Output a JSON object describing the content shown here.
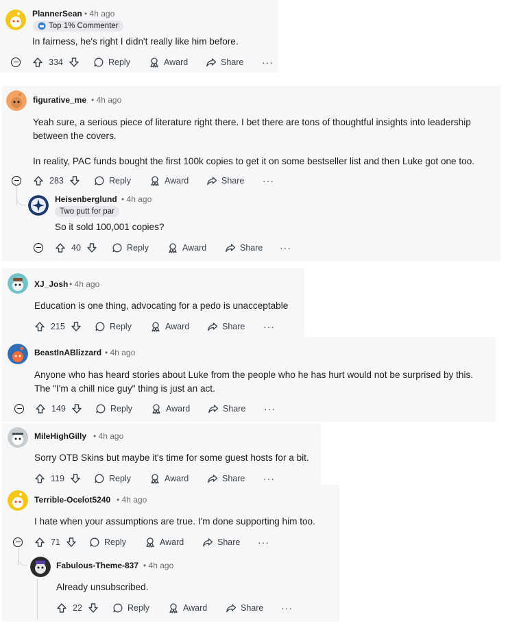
{
  "comments": [
    {
      "username": "PlannerSean",
      "time": "4h ago",
      "flair": "Top 1% Commenter",
      "lines": [
        "In fairness, he's right I didn't really like him before."
      ],
      "votes": "334",
      "reply": "Reply",
      "award": "Award",
      "share": "Share",
      "more": "···"
    },
    {
      "username": "figurative_me",
      "time": "4h ago",
      "lines": [
        "Yeah sure, a serious piece of literature right there. I bet there are tons of thoughtful insights into leadership",
        "between the covers.",
        "In reality, PAC funds bought the first 100k copies to get it on some bestseller list and then Luke got one too."
      ],
      "votes": "283",
      "reply": "Reply",
      "award": "Award",
      "share": "Share",
      "more": "···"
    },
    {
      "username": "Heisenberglund",
      "time": "4h ago",
      "flair": "Two putt for par",
      "lines": [
        "So it sold 100,001 copies?"
      ],
      "votes": "40",
      "reply": "Reply",
      "award": "Award",
      "share": "Share",
      "more": "···"
    },
    {
      "username": "XJ_Josh",
      "time": "4h ago",
      "lines": [
        "Education is one thing, advocating for a pedo is unacceptable"
      ],
      "votes": "215",
      "reply": "Reply",
      "award": "Award",
      "share": "Share",
      "more": "···"
    },
    {
      "username": "BeastInABlizzard",
      "time": "4h ago",
      "lines": [
        "Anyone who has heard stories about Luke from the people who he has hurt would not be surprised by this.",
        "The \"I'm a chill nice guy\" thing is just an act."
      ],
      "votes": "149",
      "reply": "Reply",
      "award": "Award",
      "share": "Share",
      "more": "···"
    },
    {
      "username": "MileHighGilly",
      "time": "4h ago",
      "lines": [
        "Sorry OTB Skins but maybe it's time for some guest hosts for a bit."
      ],
      "votes": "119",
      "reply": "Reply",
      "award": "Award",
      "share": "Share",
      "more": "···"
    },
    {
      "username": "Terrible-Ocelot5240",
      "time": "4h ago",
      "lines": [
        "I hate when your assumptions are true. I'm done supporting him too."
      ],
      "votes": "71",
      "reply": "Reply",
      "award": "Award",
      "share": "Share",
      "more": "···"
    },
    {
      "username": "Fabulous-Theme-837",
      "time": "4h ago",
      "lines": [
        "Already unsubscribed."
      ],
      "votes": "22",
      "reply": "Reply",
      "award": "Award",
      "share": "Share",
      "more": "···"
    }
  ],
  "colors": {
    "panel_bg": "#f6f7f8",
    "thread_line": "#d4d6d8",
    "text": "#1c1c1c",
    "meta": "#6a6c6e",
    "flair_bg": "#e5e7ea"
  },
  "icons": [
    "collapse-icon",
    "upvote-icon",
    "downvote-icon",
    "reply-icon",
    "award-icon",
    "share-icon",
    "more-icon",
    "badge-icon"
  ]
}
